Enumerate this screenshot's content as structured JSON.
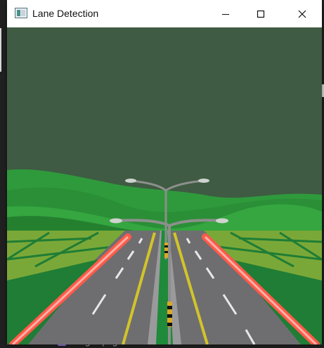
{
  "window": {
    "title": "Lane Detection",
    "controls": [
      "minimize",
      "maximize",
      "close"
    ]
  },
  "background_app": {
    "file_label": "images.png"
  },
  "scene": {
    "sky_color": "#3f5b43",
    "hill_colors": [
      "#2f9a3c",
      "#2a8f36",
      "#35a640"
    ],
    "field_color": "#7aa838",
    "road_color": "#6e6e70",
    "lane_marking_color": "#d2c42a",
    "detected_lane_color": "#ff5a4a"
  }
}
